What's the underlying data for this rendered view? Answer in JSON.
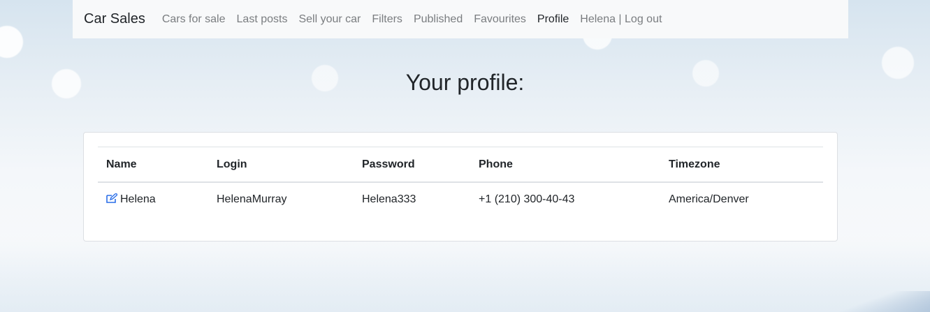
{
  "navbar": {
    "brand": "Car Sales",
    "links": [
      {
        "label": "Cars for sale",
        "active": false
      },
      {
        "label": "Last posts",
        "active": false
      },
      {
        "label": "Sell your car",
        "active": false
      },
      {
        "label": "Filters",
        "active": false
      },
      {
        "label": "Published",
        "active": false
      },
      {
        "label": "Favourites",
        "active": false
      },
      {
        "label": "Profile",
        "active": true
      },
      {
        "label": "Helena | Log out",
        "active": false
      }
    ]
  },
  "page": {
    "title": "Your profile:"
  },
  "profile_table": {
    "headers": [
      "Name",
      "Login",
      "Password",
      "Phone",
      "Timezone"
    ],
    "row": {
      "name": "Helena",
      "login": "HelenaMurray",
      "password": "Helena333",
      "phone": "+1 (210) 300-40-43",
      "timezone": "America/Denver"
    },
    "edit_icon": "edit-icon",
    "edit_icon_color": "#2a6ee8"
  }
}
